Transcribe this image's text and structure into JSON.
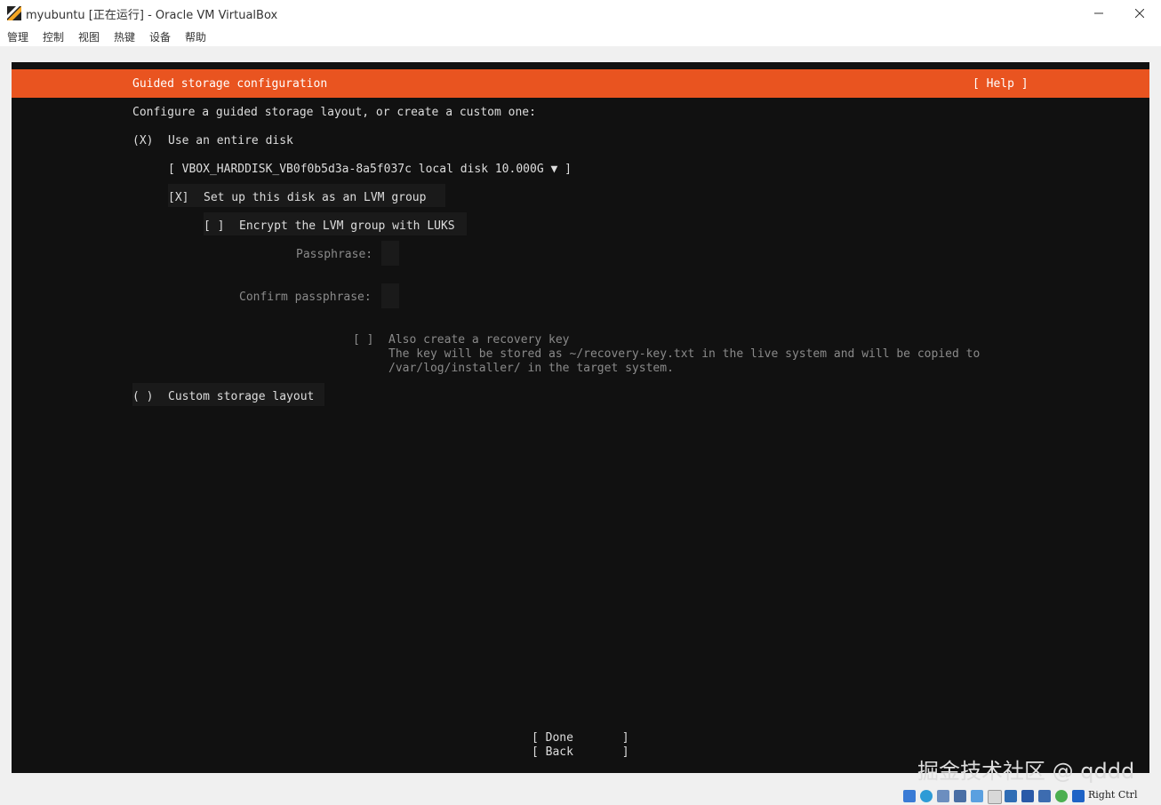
{
  "window": {
    "title": "myubuntu [正在运行] - Oracle VM VirtualBox",
    "minimize_icon": "minimize-icon",
    "maximize_icon": "maximize-icon",
    "close_icon": "close-icon"
  },
  "menubar": {
    "items": [
      "管理",
      "控制",
      "视图",
      "热键",
      "设备",
      "帮助"
    ]
  },
  "installer": {
    "header_title": "Guided storage configuration",
    "help_button": "[ Help ]",
    "prompt": "Configure a guided storage layout, or create a custom one:",
    "use_entire_disk": {
      "marker": "(X)",
      "label": "Use an entire disk"
    },
    "disk_select": "[ VBOX_HARDDISK_VB0f0b5d3a-8a5f037c local disk 10.000G ▼ ]",
    "lvm_group": {
      "marker": "[X]",
      "label": "Set up this disk as an LVM group"
    },
    "encrypt_luks": {
      "marker": "[ ]",
      "label": "Encrypt the LVM group with LUKS"
    },
    "passphrase_label": "Passphrase:",
    "confirm_passphrase_label": "Confirm passphrase:",
    "recovery_key": {
      "marker": "[ ]",
      "label": "Also create a recovery key",
      "desc1": "The key will be stored as ~/recovery-key.txt in the live system and will be copied to",
      "desc2": "/var/log/installer/ in the target system."
    },
    "custom_layout": {
      "marker": "( )",
      "label": "Custom storage layout"
    },
    "done_button": "[ Done       ]",
    "back_button": "[ Back       ]",
    "header_color": "#e95420"
  },
  "statusbar": {
    "right_ctrl": "Right Ctrl",
    "icons": [
      "hard-disk-icon",
      "optical-disk-icon",
      "audio-icon",
      "network-icon",
      "usb-icon",
      "shared-folder-icon",
      "display-icon",
      "recording-icon",
      "video-capture-icon",
      "mouse-integration-icon",
      "cpu-icon",
      "keyboard-arrow-icon"
    ]
  },
  "watermark": "掘金技术社区 @ qddd"
}
